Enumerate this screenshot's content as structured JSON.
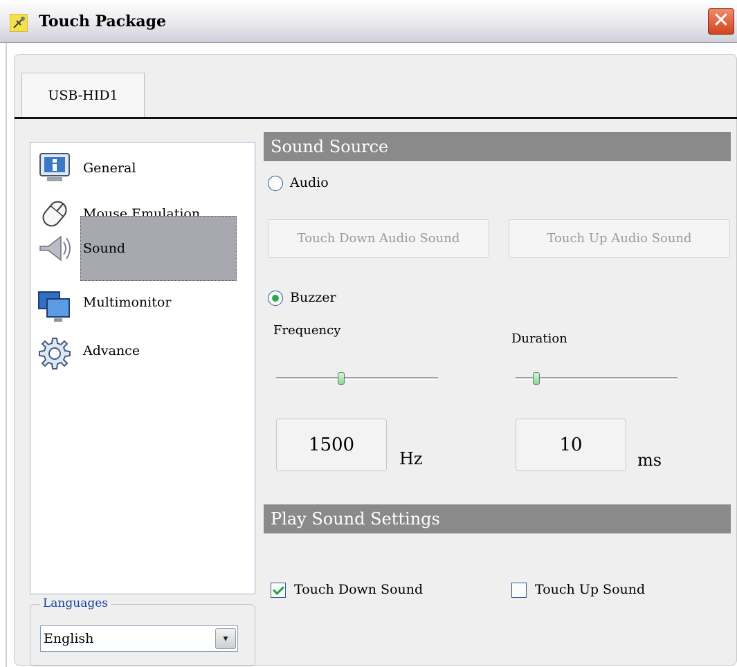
{
  "window": {
    "title": "Touch Package",
    "close_symbol": "✕"
  },
  "tabs": [
    {
      "label": "USB-HID1",
      "selected": true
    }
  ],
  "sidebar": {
    "items": [
      {
        "label": "General",
        "icon": "monitor-info-icon"
      },
      {
        "label": "Mouse Emulation",
        "icon": "mouse-icon"
      },
      {
        "label": "Sound",
        "icon": "speaker-icon",
        "selected": true
      },
      {
        "label": "Multimonitor",
        "icon": "multimonitor-icon"
      },
      {
        "label": "Advance",
        "icon": "gear-icon"
      }
    ]
  },
  "languages": {
    "legend": "Languages",
    "selected": "English",
    "arrow": "▾"
  },
  "sound_source": {
    "header": "Sound Source",
    "audio": {
      "label": "Audio",
      "selected": false
    },
    "touch_down_audio_button": "Touch Down Audio Sound",
    "touch_up_audio_button": "Touch Up Audio Sound",
    "buzzer": {
      "label": "Buzzer",
      "selected": true
    },
    "frequency": {
      "label": "Frequency",
      "value": "1500",
      "unit": "Hz",
      "slider_fraction": 0.4
    },
    "duration": {
      "label": "Duration",
      "value": "10",
      "unit": "ms",
      "slider_fraction": 0.13
    }
  },
  "play_sound": {
    "header": "Play Sound Settings",
    "touch_down": {
      "label": "Touch Down Sound",
      "checked": true
    },
    "touch_up": {
      "label": "Touch Up Sound",
      "checked": false
    }
  },
  "colors": {
    "header_bg": "#8a8a8a",
    "selected_nav_bg": "#a7a8b0",
    "accent_green": "#2aa84a"
  }
}
